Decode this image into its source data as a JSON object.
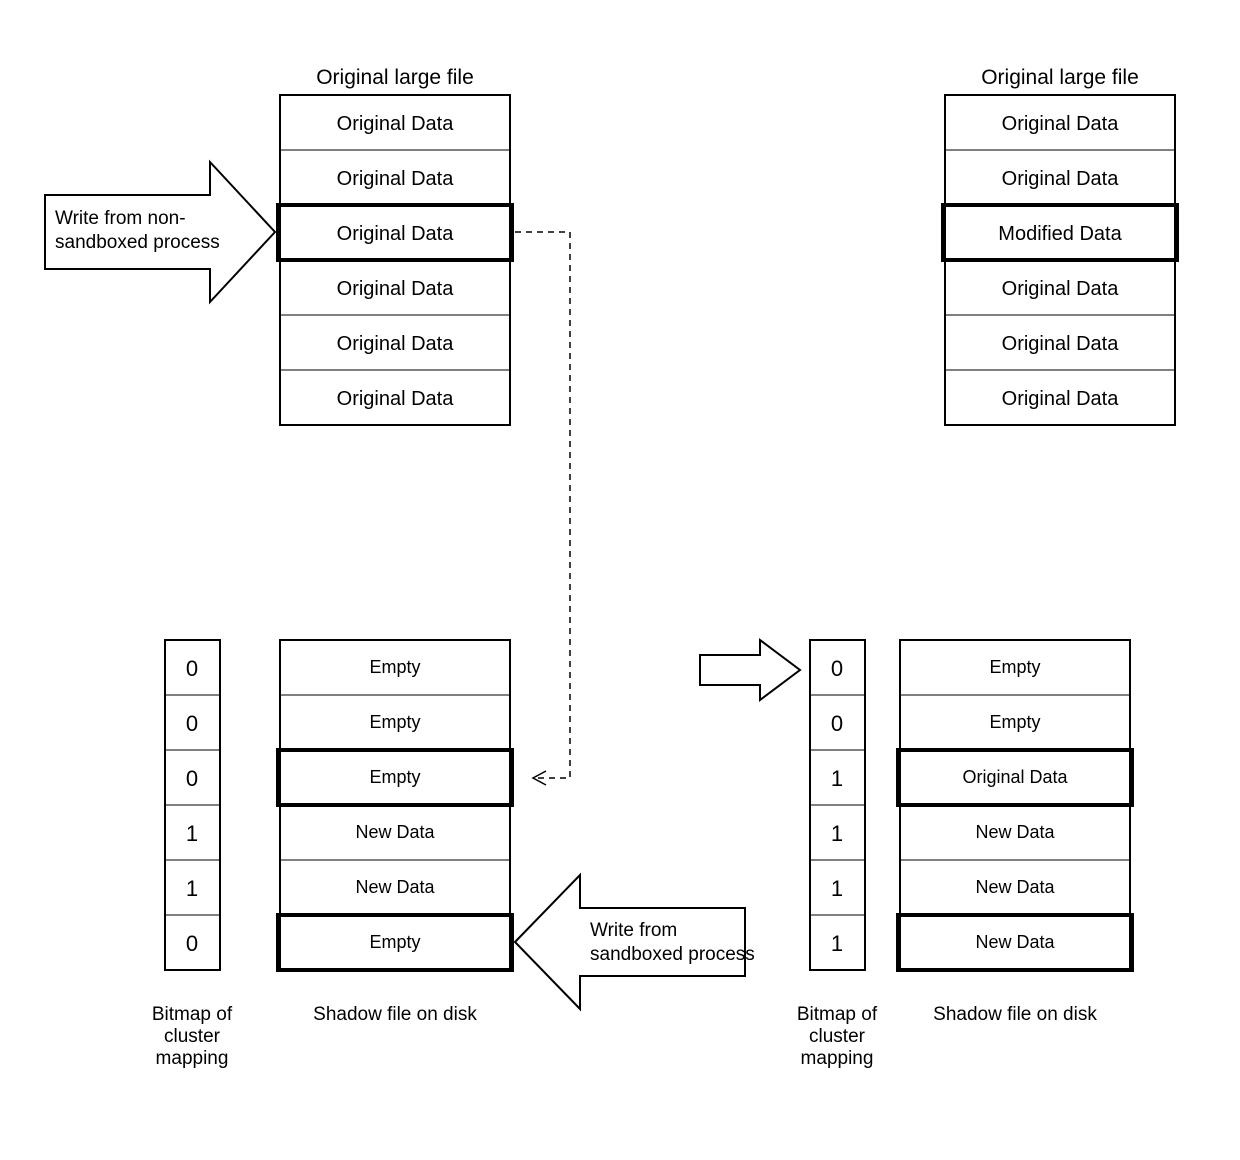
{
  "top": {
    "title": "Original large file",
    "left": {
      "rows": [
        "Original Data",
        "Original Data",
        "Original Data",
        "Original Data",
        "Original Data",
        "Original Data"
      ],
      "highlight": 2
    },
    "right": {
      "rows": [
        "Original Data",
        "Original Data",
        "Modified Data",
        "Original Data",
        "Original Data",
        "Original Data"
      ],
      "highlight": 2
    }
  },
  "bottom": {
    "bitmap_caption": "Bitmap of cluster mapping",
    "shadow_caption": "Shadow file on disk",
    "left": {
      "bits": [
        "0",
        "0",
        "0",
        "1",
        "1",
        "0"
      ],
      "rows": [
        "Empty",
        "Empty",
        "Empty",
        "New Data",
        "New Data",
        "Empty"
      ],
      "highlightA": 2,
      "highlightB": 5
    },
    "right": {
      "bits": [
        "0",
        "0",
        "1",
        "1",
        "1",
        "1"
      ],
      "rows": [
        "Empty",
        "Empty",
        "Original Data",
        "New  Data",
        "New Data",
        "New Data"
      ],
      "highlightA": 2,
      "highlightB": 5
    }
  },
  "arrows": {
    "nonsandboxed": "Write from non-\nsandboxed process",
    "sandboxed": "Write from sandboxed process"
  }
}
